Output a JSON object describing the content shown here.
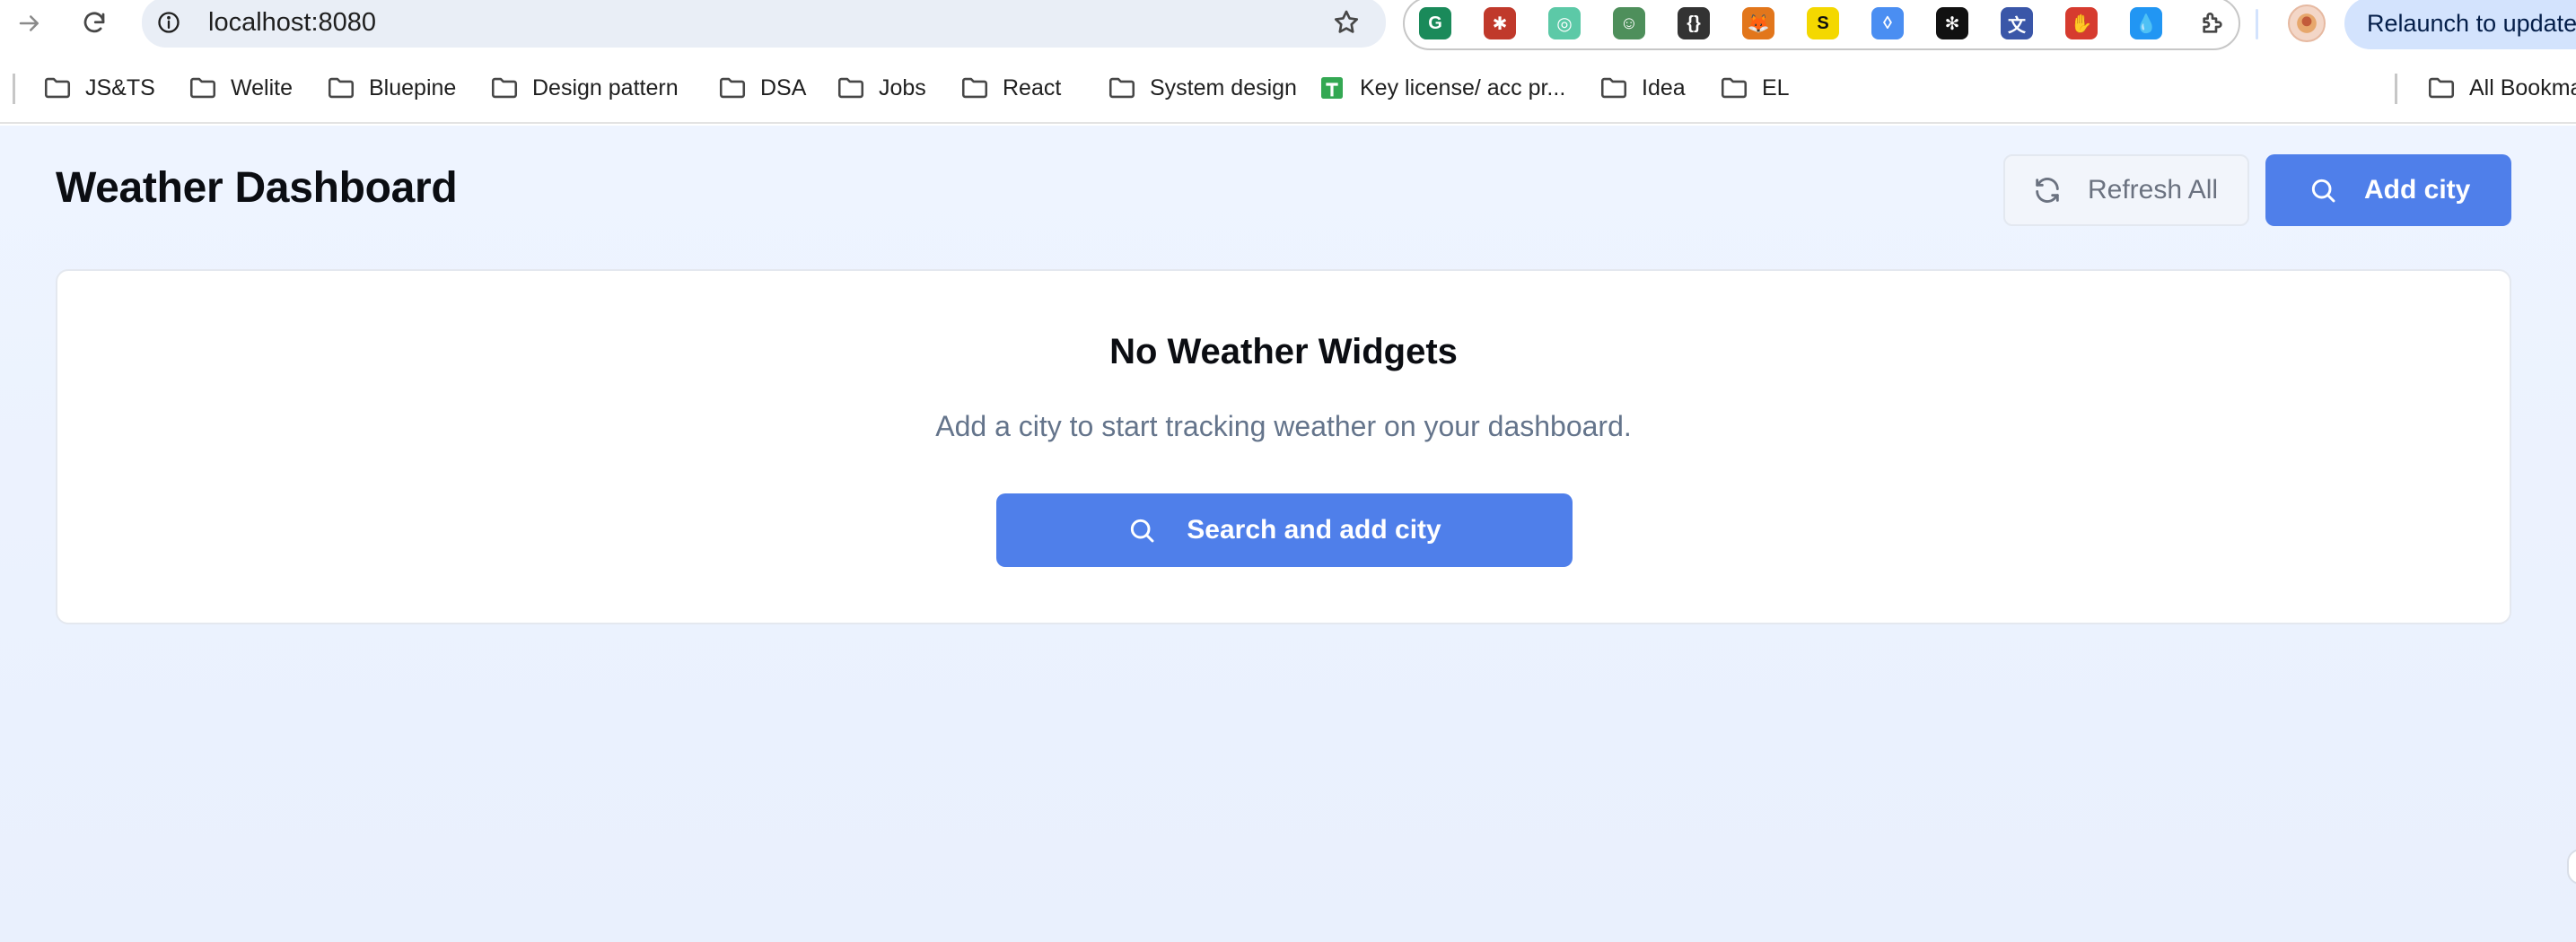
{
  "browser": {
    "url": "localhost:8080",
    "relaunch_label": "Relaunch to update",
    "extensions": [
      {
        "name": "grammarly-extension-icon",
        "color": "#1a8a5a",
        "glyph": "G"
      },
      {
        "name": "bug-extension-icon",
        "color": "#c0392b",
        "glyph": "✱"
      },
      {
        "name": "target-extension-icon",
        "color": "#5cc9a7",
        "glyph": "◎"
      },
      {
        "name": "robot-extension-icon",
        "color": "#4e8f5b",
        "glyph": "☺"
      },
      {
        "name": "braces-extension-icon",
        "color": "#333333",
        "glyph": "{}"
      },
      {
        "name": "metamask-extension-icon",
        "color": "#e2761b",
        "glyph": "🦊"
      },
      {
        "name": "s-extension-icon",
        "color": "#f4d800",
        "glyph": "S"
      },
      {
        "name": "drop-extension-icon",
        "color": "#4a8ef2",
        "glyph": "◊"
      },
      {
        "name": "snowflake-extension-icon",
        "color": "#111111",
        "glyph": "✻"
      },
      {
        "name": "translate-extension-icon",
        "color": "#3a56a8",
        "glyph": "文"
      },
      {
        "name": "hand-extension-icon",
        "color": "#d63b2f",
        "glyph": "✋"
      },
      {
        "name": "water-drop-extension-icon",
        "color": "#2196f3",
        "glyph": "💧"
      }
    ]
  },
  "bookmarks": {
    "items": [
      {
        "label": "JS&TS",
        "type": "folder"
      },
      {
        "label": "Welite",
        "type": "folder"
      },
      {
        "label": "Bluepine",
        "type": "folder"
      },
      {
        "label": "Design pattern",
        "type": "folder"
      },
      {
        "label": "DSA",
        "type": "folder"
      },
      {
        "label": "Jobs",
        "type": "folder"
      },
      {
        "label": "React",
        "type": "folder"
      },
      {
        "label": "System design",
        "type": "folder"
      },
      {
        "label": "Key license/ acc pr...",
        "type": "sheet"
      },
      {
        "label": "Idea",
        "type": "folder"
      },
      {
        "label": "EL",
        "type": "folder"
      }
    ],
    "all_bookmarks_label": "All Bookmarks"
  },
  "page": {
    "title": "Weather Dashboard",
    "refresh_label": "Refresh All",
    "add_city_label": "Add city",
    "empty_state": {
      "title": "No Weather Widgets",
      "subtitle": "Add a city to start tracking weather on your dashboard.",
      "button_label": "Search and add city"
    }
  },
  "colors": {
    "primary": "#4f7fea",
    "page_background": "#eef4ff",
    "muted_text": "#64748b"
  }
}
